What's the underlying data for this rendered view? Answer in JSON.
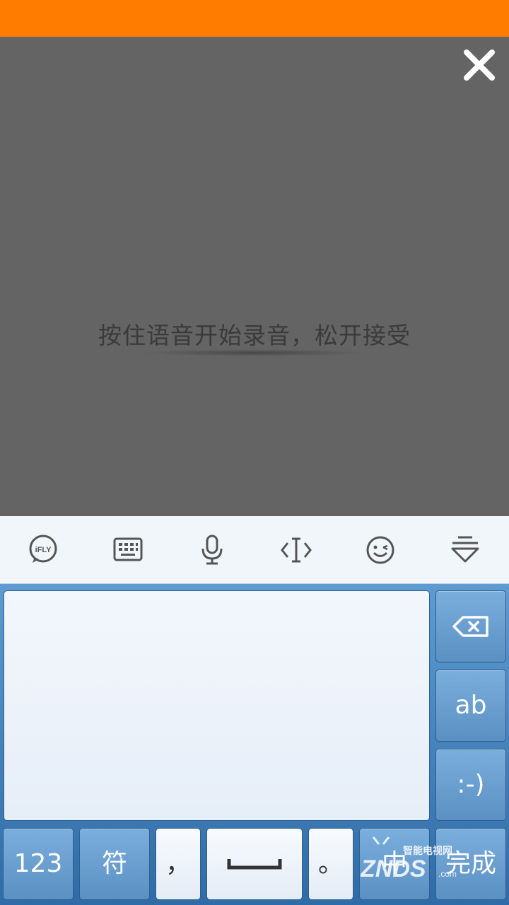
{
  "overlay": {
    "hint": "按住语音开始录音，松开接受"
  },
  "toolbar": {
    "icons": [
      "ifly-logo-icon",
      "keyboard-icon",
      "microphone-icon",
      "cursor-edit-icon",
      "emoji-icon",
      "hide-keyboard-icon"
    ],
    "ifly_text": "iFLY"
  },
  "keyboard": {
    "side_keys": {
      "delete_icon": "backspace-icon",
      "ab": "ab",
      "smiley": ":-)"
    },
    "bottom_keys": {
      "num": "123",
      "symbol": "符",
      "comma": "，",
      "period": "。",
      "lang": "中",
      "done": "完成"
    }
  },
  "watermark": {
    "top": "智能电视网",
    "brand": "ZNDS",
    "suffix": ".com"
  },
  "colors": {
    "status_bar": "#ff7c00",
    "overlay": "#646464",
    "key_blue": "#6a9fd0",
    "toolbar_bg": "#f1f6fb"
  }
}
